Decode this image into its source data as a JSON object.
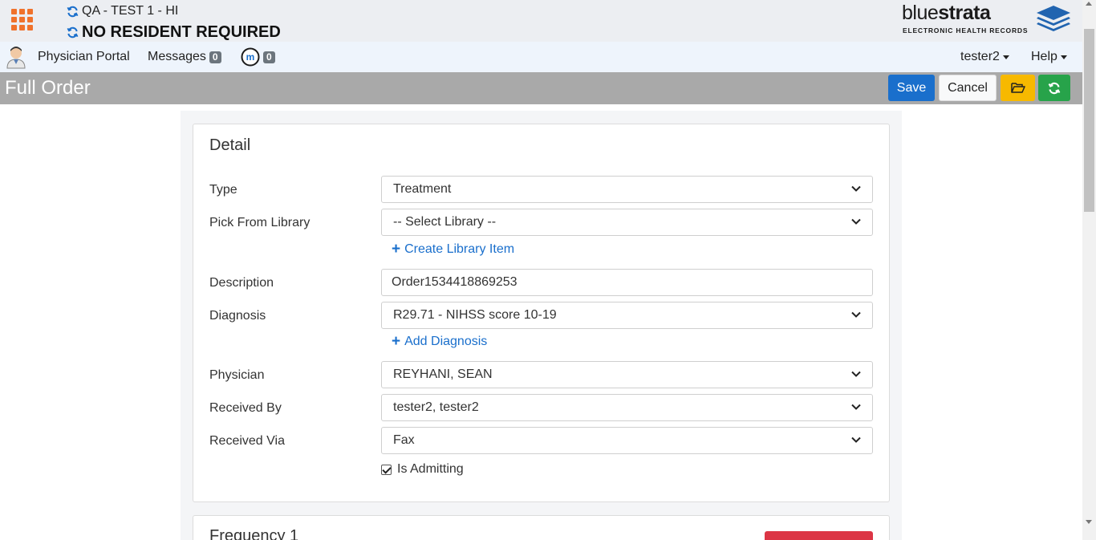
{
  "header": {
    "facility": "QA - TEST 1 - HI",
    "resident": "NO RESIDENT REQUIRED",
    "brand_light": "blue",
    "brand_bold": "strata",
    "brand_sub": "ELECTRONIC HEALTH RECORDS",
    "accent_color": "#f0722c"
  },
  "nav": {
    "portal_label": "Physician Portal",
    "messages_label": "Messages",
    "messages_count": "0",
    "m_count": "0",
    "user_label": "tester2",
    "help_label": "Help"
  },
  "toolbar": {
    "title": "Full Order",
    "save_label": "Save",
    "cancel_label": "Cancel"
  },
  "detail": {
    "title": "Detail",
    "type_label": "Type",
    "type_value": "Treatment",
    "library_label": "Pick From Library",
    "library_value": "-- Select Library --",
    "create_library_label": "Create Library Item",
    "description_label": "Description",
    "description_value": "Order1534418869253",
    "diagnosis_label": "Diagnosis",
    "diagnosis_value": "R29.71 - NIHSS score 10-19",
    "add_diagnosis_label": "Add Diagnosis",
    "physician_label": "Physician",
    "physician_value": "REYHANI, SEAN",
    "received_by_label": "Received By",
    "received_by_value": "tester2, tester2",
    "received_via_label": "Received Via",
    "received_via_value": "Fax",
    "is_admitting_label": "Is Admitting",
    "is_admitting_checked": true
  },
  "frequency": {
    "title": "Frequency 1"
  }
}
